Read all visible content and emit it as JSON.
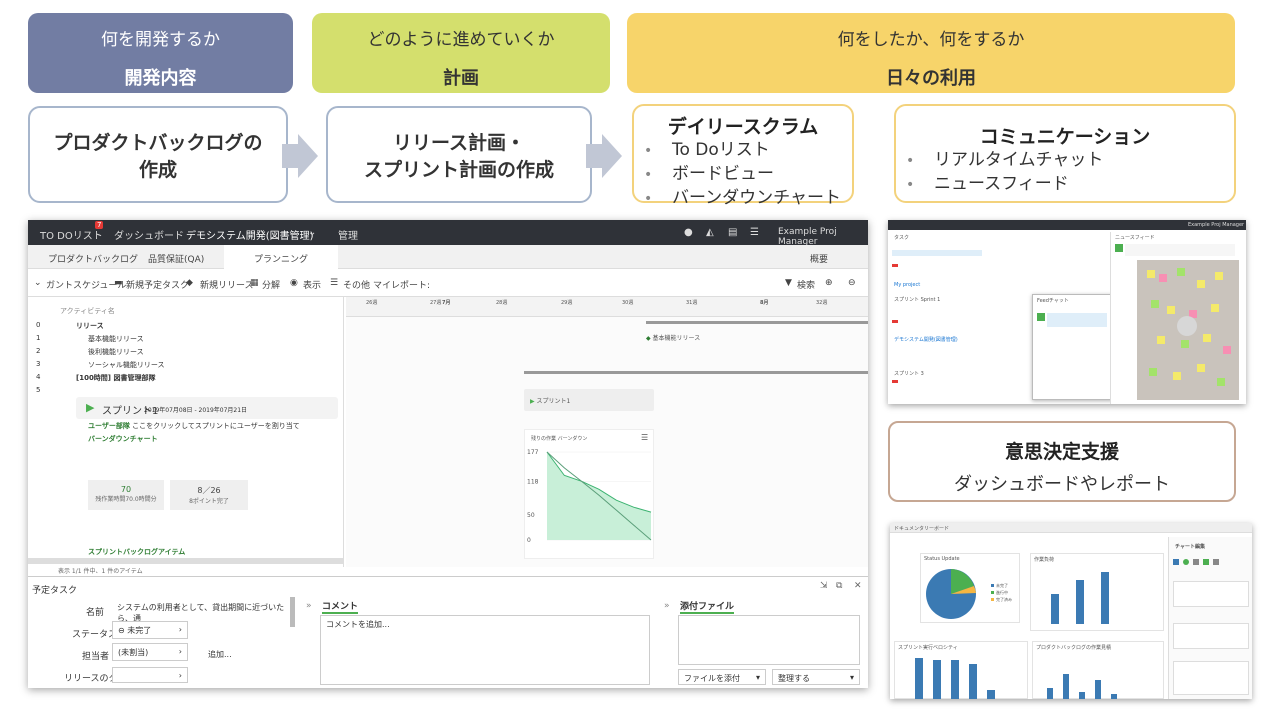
{
  "banners": [
    {
      "sub": "何を開発するか",
      "main": "開発内容"
    },
    {
      "sub": "どのように進めていくか",
      "main": "計画"
    },
    {
      "sub": "何をしたか、何をするか",
      "main": "日々の利用"
    }
  ],
  "steps": {
    "backlog": {
      "line1": "プロダクトバックログの",
      "line2": "作成"
    },
    "release": {
      "line1": "リリース計画・",
      "line2": "スプリント計画の作成"
    },
    "daily": {
      "title": "デイリースクラム",
      "items": [
        "To Doリスト",
        "ボードビュー",
        "バーンダウンチャート"
      ]
    },
    "comm": {
      "title": "コミュニケーション",
      "items": [
        "リアルタイムチャット",
        "ニュースフィード"
      ]
    }
  },
  "decision": {
    "title": "意思決定支援",
    "sub": "ダッシュボードやレポート"
  },
  "colors": {
    "banner1": "#727da3",
    "banner2": "#d4df6d",
    "banner3": "#f7d46a",
    "accent": "#4caf50"
  },
  "app": {
    "nav": {
      "todo": "TO DOリスト",
      "badge": "7",
      "dashboard": "ダッシュボード",
      "project": "デモシステム開発(図書管理)",
      "manage": "管理",
      "user": "Example Proj Manager"
    },
    "tabs": {
      "backlog": "プロダクトバックログ",
      "qa": "品質保証(QA)",
      "planning": "プランニング",
      "overview": "概要"
    },
    "toolbar": {
      "gantt": "ガントスケジュール",
      "newtask": "新規予定タスク",
      "newrelease": "新規リリース",
      "split": "分解",
      "view": "表示",
      "other": "その他",
      "myreport": "マイレポート:",
      "search": "検索"
    },
    "grid_header": "アクティビティ名",
    "rows": [
      {
        "no": "0",
        "name": "リリース"
      },
      {
        "no": "1",
        "name": "基本機能リリース"
      },
      {
        "no": "2",
        "name": "後利機能リリース"
      },
      {
        "no": "3",
        "name": "ソーシャル機能リリース"
      },
      {
        "no": "4",
        "name": "[100時間] 図書管理部隊"
      },
      {
        "no": "5",
        "name": ""
      }
    ],
    "sprint": {
      "name": "スプリント1",
      "dates": "2019年07月08日 - 2019年07月21日",
      "user_story": "ユーザー部隊",
      "user_story_desc": "ここをクリックしてスプリントにユーザーを割り当て",
      "burndown": "バーンダウンチャート",
      "stat1_value": "70",
      "stat1_label": "残作業時間70.0時間分",
      "stat2_value": "8／26",
      "stat2_label": "8ポイント完了",
      "backlog_items": "スプリントバックログアイテム"
    },
    "footer_note": "表示 1/1 件中、1 件のアイテム",
    "gantt": {
      "weeks": [
        "26週",
        "27週",
        "7月",
        "28週",
        "29週",
        "30週",
        "31週",
        "8月",
        "32週"
      ],
      "release_label": "基本機能リリース",
      "sprint_label": "スプリント1",
      "chart_title": "残りの作業 バーンダウン"
    },
    "bottom": {
      "panel_title": "予定タスク",
      "name_label": "名前",
      "name_value": "システムの利用者として、貸出期間に近づいたら、通",
      "status_label": "ステータス",
      "status_value": "未完了",
      "assignee_label": "担当者",
      "assignee_value": "(未割当)",
      "add": "追加...",
      "release_tag": "リリースのタグ",
      "comment_title": "コメント",
      "comment_placeholder": "コメントを追加...",
      "attach_title": "添付ファイル",
      "attach_btn": "ファイルを添付",
      "organize_btn": "整理する"
    }
  },
  "chart_data": {
    "type": "area",
    "title": "残りの作業 バーンダウン",
    "y_ticks": [
      "177",
      "118",
      "50",
      "0"
    ],
    "ylim": [
      0,
      177
    ],
    "series": [
      {
        "values": [
          177,
          130,
          118,
          102,
          80,
          66,
          56
        ]
      },
      {
        "values": [
          177,
          145,
          118,
          90,
          60,
          30,
          0
        ]
      }
    ]
  },
  "shot1": {
    "title": "Example Proj Manager",
    "chat": "Feedチャット",
    "newsfeed": "ニュースフィード",
    "items": [
      "タスク",
      "スプリント Sprint 1",
      "スプリント 3",
      "デモシステム開発(図書管理)"
    ],
    "section": "My project"
  },
  "shot2": {
    "title": "ドキュメンタリーボード",
    "panel": "チャート編集",
    "charts": [
      {
        "title": "Status Update"
      },
      {
        "title": "作業負荷"
      },
      {
        "title": "スプリント実行ベロシティ"
      },
      {
        "title": "プロダクトバックログの作業見積"
      }
    ],
    "legend": [
      "未完了",
      "進行中",
      "完了済み"
    ]
  }
}
